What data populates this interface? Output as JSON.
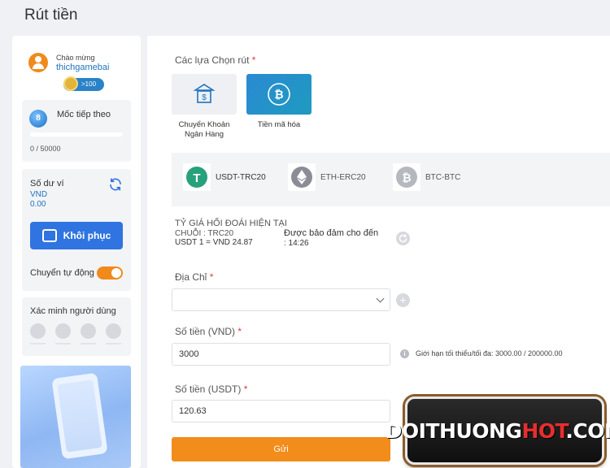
{
  "page": {
    "title": "Rút tiền"
  },
  "sidebar": {
    "welcome_label": "Chào mừng",
    "username": "thichgamebai",
    "vip_badge": ">100",
    "level_label": "Mốc tiếp theo",
    "level_number": "8",
    "level_progress": "0 / 50000",
    "wallet_label": "Số dư ví",
    "wallet_currency": "VND",
    "wallet_amount": "0.00",
    "restore_label": "Khôi phục",
    "auto_transfer_label": "Chuyển tự động",
    "auto_transfer_on": true,
    "verify_label": "Xác minh người dùng",
    "verify_icons": [
      "user-icon",
      "email-icon",
      "phone-icon",
      "id-card-icon"
    ]
  },
  "main": {
    "method_section_label": "Các lựa Chọn rút",
    "methods": [
      {
        "label_line1": "Chuyển Khoản",
        "label_line2": "Ngân Hàng",
        "icon": "bank-icon",
        "selected": false
      },
      {
        "label_line1": "Tiền mã hóa",
        "label_line2": "",
        "icon": "bitcoin-icon",
        "selected": true
      }
    ],
    "coins": [
      {
        "label": "USDT-TRC20",
        "icon": "tether-icon",
        "active": true
      },
      {
        "label": "ETH-ERC20",
        "icon": "ethereum-icon",
        "active": false
      },
      {
        "label": "BTC-BTC",
        "icon": "bitcoin-icon",
        "active": false
      }
    ],
    "rate_title": "TỶ GIÁ HỐI ĐOÁI HIỆN TẠI",
    "rate_chain": "CHUỖI : TRC20",
    "rate_value": "USDT 1 = VND 24.87",
    "rate_guarantee_line1": "Được bảo đảm cho đến",
    "rate_guarantee_line2": ": 14:26",
    "address_label": "Địa Chỉ",
    "address_value": "",
    "amount_vnd_label": "Số tiền (VND)",
    "amount_vnd_value": "3000",
    "limit_text": "Giới hạn tối thiểu/tối đa: 3000.00 / 200000.00",
    "amount_usdt_label": "Số tiền (USDT)",
    "amount_usdt_value": "120.63",
    "required_mark": "*",
    "submit_label": "Gửi"
  },
  "watermark": {
    "text_a": "DOITHUONG",
    "text_b": "HOT",
    "text_c": ".COM"
  },
  "colors": {
    "accent_orange": "#f28c1a",
    "primary_blue": "#2f74e0",
    "crypto_tile": "#2b8ad3"
  }
}
